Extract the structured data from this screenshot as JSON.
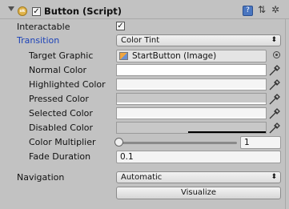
{
  "component": {
    "title": "Button (Script)",
    "script_icon_label": "ok",
    "enabled": true,
    "icons": [
      "reference-book-icon",
      "settings-sliders-icon",
      "gear-icon"
    ]
  },
  "fields": {
    "interactable": {
      "label": "Interactable",
      "checked": true
    },
    "transition": {
      "label": "Transition",
      "value": "Color Tint"
    },
    "target_graphic": {
      "label": "Target Graphic",
      "value": "StartButton (Image)"
    },
    "normal_color": {
      "label": "Normal Color",
      "color": "#ffffff"
    },
    "highlighted_color": {
      "label": "Highlighted Color",
      "color": "#f5f5f5"
    },
    "pressed_color": {
      "label": "Pressed Color",
      "color": "#c8c8c8"
    },
    "selected_color": {
      "label": "Selected Color",
      "color": "#f5f5f5"
    },
    "disabled_color": {
      "label": "Disabled Color",
      "color": "#c8c8c8",
      "alpha": 0.5
    },
    "color_multiplier": {
      "label": "Color Multiplier",
      "value": "1",
      "slider_fraction": 0.0
    },
    "fade_duration": {
      "label": "Fade Duration",
      "value": "0.1"
    },
    "navigation": {
      "label": "Navigation",
      "value": "Automatic"
    },
    "visualize": {
      "label": "Visualize"
    }
  },
  "glyphs": {
    "check": "✓",
    "dropdown_arrow": "⬍"
  }
}
